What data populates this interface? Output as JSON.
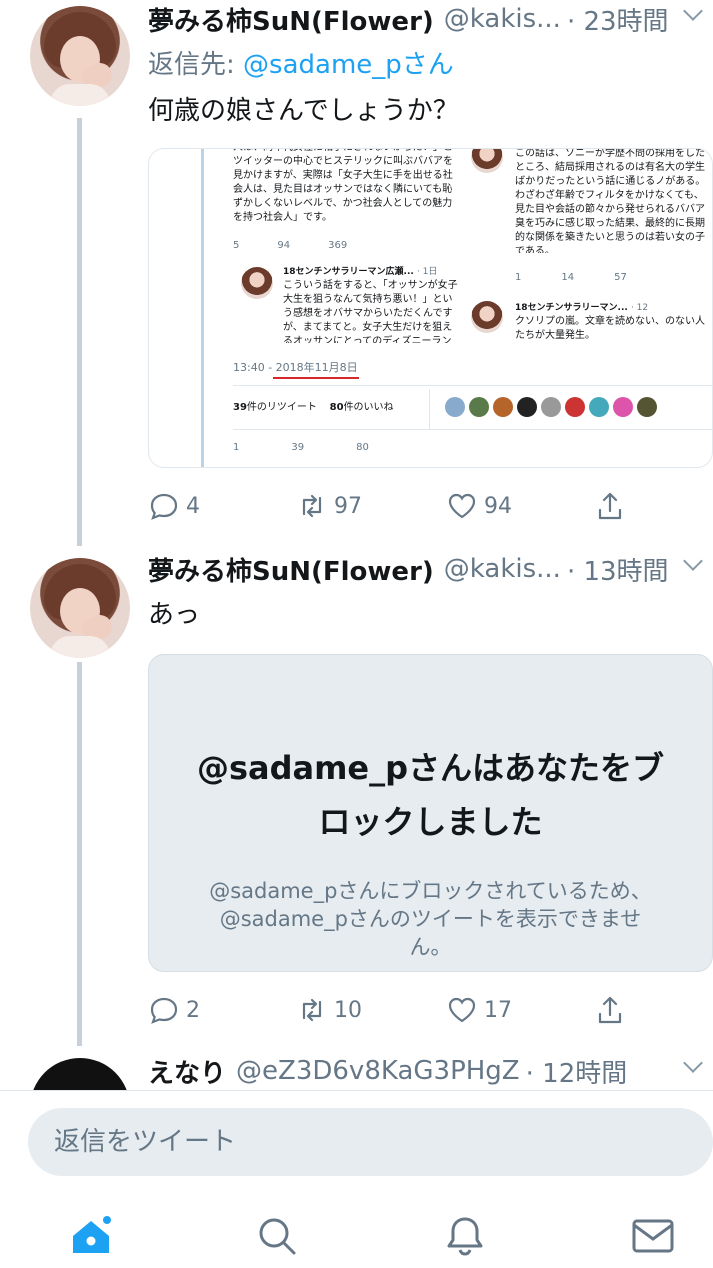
{
  "tweets": [
    {
      "name": "夢みる柿SuN(Flower)",
      "handle": "@kakis...",
      "time": "· 23時間",
      "reply_prefix": "返信先:",
      "reply_mention": "@sadame_pさん",
      "text": "何歳の娘さんでしょうか？",
      "replies": "4",
      "retweets": "97",
      "likes": "94"
    },
    {
      "name": "夢みる柿SuN(Flower)",
      "handle": "@kakis...",
      "time": "· 13時間",
      "text": "あっ",
      "replies": "2",
      "retweets": "10",
      "likes": "17"
    },
    {
      "name": "えなり",
      "handle": "@eZ3D6v8KaG3PHgZ",
      "time": "· 12時間"
    }
  ],
  "blocked": {
    "title": "@sadame_pさんはあなたをブロックしました",
    "subtitle": "@sadame_pさんにブロックされているため、@sadame_pさんのツイートを表示できません。"
  },
  "embedded_screenshot": {
    "left_text": "人は、同年代女性に相手にされないからだ！」とツイッターの中心でヒステリックに叫ぶババアを見かけますが、実際は「女子大生に手を出せる社会人は、見た目はオッサンではなく隣にいても恥ずかしくないレベルで、かつ社会人としての魅力を持つ社会人」です。",
    "left_counts": [
      "5",
      "94",
      "369"
    ],
    "reply_name": "18センチンサラリーマン広瀬...",
    "reply_time": "· 1日",
    "reply_text": "こういう話をすると、「オッサンが女子大生を狙うなんて気持ち悪い！」という感想をオバサマからいただくんですが、まてまてと。女子大生だけを狙えるオッサンにとってのディズニーランドがあるなら教えてくれ。",
    "right_text": "この話は、ソニーが学歴不問の採用をしたところ、結局採用されるのは有名大の学生ばかりだったという話に通じるノがある。わざわざ年齢でフィルタをかけなくても、見た目や会話の節々から発せられるババア臭を巧みに感じ取った結果、最終的に長期的な関係を築きたいと思うのは若い女の子である。",
    "right_counts": [
      "1",
      "14",
      "57"
    ],
    "right_reply_name": "18センチンサラリーマン...",
    "right_reply_time": "· 12",
    "right_reply_text": "クソリプの嵐。文章を読めない、のない人たちが大量発生。",
    "timestamp_time": "13:40 -",
    "timestamp_date": "2018年11月8日",
    "rt_count": "39",
    "rt_label": "件のリツイート",
    "like_count": "80",
    "like_label": "件のいいね",
    "bottom_counts": [
      "1",
      "39",
      "80"
    ]
  },
  "composer": {
    "placeholder": "返信をツイート"
  },
  "tabs": [
    "home-icon",
    "search-icon",
    "notifications-icon",
    "messages-icon"
  ],
  "colors": {
    "accent": "#1da1f2",
    "muted": "#657786",
    "thread_line": "#c8d1d9",
    "blocked_bg": "#e6ecf0"
  }
}
